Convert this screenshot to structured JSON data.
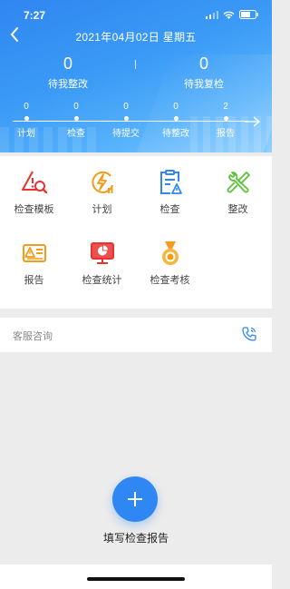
{
  "status": {
    "time": "7:27"
  },
  "header": {
    "date_title": "2021年04月02日  星期五",
    "stats": [
      {
        "value": "0",
        "label": "待我整改"
      },
      {
        "value": "0",
        "label": "待我复检"
      }
    ],
    "timeline": [
      {
        "value": "0",
        "label": "计划"
      },
      {
        "value": "0",
        "label": "检查"
      },
      {
        "value": "0",
        "label": "待提交"
      },
      {
        "value": "0",
        "label": "待整改"
      },
      {
        "value": "2",
        "label": "报告"
      }
    ]
  },
  "menu": [
    {
      "label": "检查模板",
      "icon": "warning-search-icon",
      "color": "#e8332f"
    },
    {
      "label": "计划",
      "icon": "lightning-chart-icon",
      "color": "#f39b1a"
    },
    {
      "label": "检查",
      "icon": "clipboard-warning-icon",
      "color": "#2e87f2"
    },
    {
      "label": "整改",
      "icon": "wrench-screwdriver-icon",
      "color": "#5cc23a"
    },
    {
      "label": "报告",
      "icon": "report-warning-icon",
      "color": "#f39b1a"
    },
    {
      "label": "检查统计",
      "icon": "monitor-pie-icon",
      "color": "#e8332f"
    },
    {
      "label": "检查考核",
      "icon": "medal-icon",
      "color": "#f39b1a"
    }
  ],
  "service": {
    "label": "客服咨询"
  },
  "fab": {
    "label": "填写检查报告"
  }
}
